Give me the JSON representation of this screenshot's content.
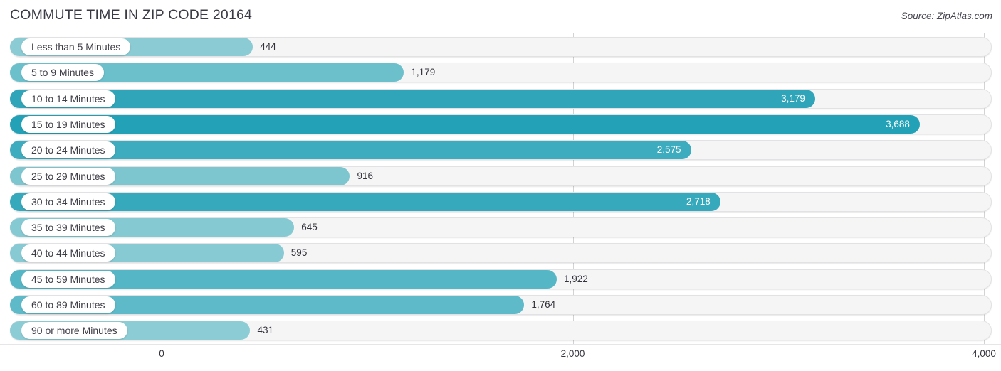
{
  "header": {
    "title": "COMMUTE TIME IN ZIP CODE 20164",
    "source": "Source: ZipAtlas.com"
  },
  "axis": {
    "ticks": [
      "0",
      "2,000",
      "4,000"
    ]
  },
  "chart_data": {
    "type": "bar",
    "orientation": "horizontal",
    "title": "COMMUTE TIME IN ZIP CODE 20164",
    "subtitle": "Source: ZipAtlas.com",
    "xlabel": "",
    "ylabel": "",
    "xlim": [
      0,
      4000
    ],
    "xticks": [
      0,
      2000,
      4000
    ],
    "xtick_labels": [
      "0",
      "2,000",
      "4,000"
    ],
    "grid": true,
    "legend": "none",
    "categories": [
      "Less than 5 Minutes",
      "5 to 9 Minutes",
      "10 to 14 Minutes",
      "15 to 19 Minutes",
      "20 to 24 Minutes",
      "25 to 29 Minutes",
      "30 to 34 Minutes",
      "35 to 39 Minutes",
      "40 to 44 Minutes",
      "45 to 59 Minutes",
      "60 to 89 Minutes",
      "90 or more Minutes"
    ],
    "values": [
      444,
      1179,
      3179,
      3688,
      2575,
      916,
      2718,
      645,
      595,
      1922,
      1764,
      431
    ],
    "value_labels": [
      "444",
      "1,179",
      "3,179",
      "3,688",
      "2,575",
      "916",
      "2,718",
      "645",
      "595",
      "1,922",
      "1,764",
      "431"
    ],
    "bar_colors": [
      "#8BCBD4",
      "#6CC0CC",
      "#30A5B9",
      "#23A1B6",
      "#3CACBE",
      "#7DC6D0",
      "#36A9BC",
      "#85C9D2",
      "#87CAD3",
      "#55B6C5",
      "#5EBAC8",
      "#8CCCD5"
    ],
    "label_inside": [
      false,
      false,
      true,
      true,
      true,
      false,
      true,
      false,
      false,
      false,
      false,
      false
    ]
  },
  "style": {
    "track_fill": "#f5f5f6",
    "track_border": "#e2e2e4",
    "gridline_color": "#d3d3d6",
    "text_color": "#33333c",
    "inside_label_color": "#ffffff"
  }
}
